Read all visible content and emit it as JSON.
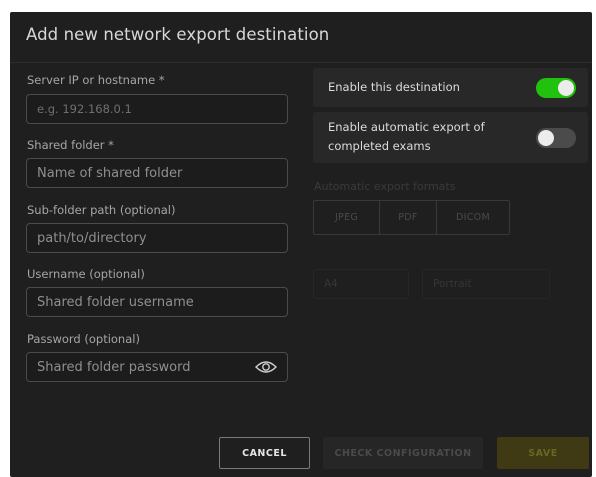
{
  "dialog": {
    "title": "Add new network export destination"
  },
  "form": {
    "server": {
      "label": "Server IP or hostname *",
      "placeholder": "e.g. 192.168.0.1"
    },
    "shared_folder": {
      "label": "Shared folder *",
      "placeholder": "Name of shared folder"
    },
    "sub_folder": {
      "label": "Sub-folder path (optional)",
      "placeholder": "path/to/directory"
    },
    "username": {
      "label": "Username (optional)",
      "placeholder": "Shared folder username"
    },
    "password": {
      "label": "Password (optional)",
      "placeholder": "Shared folder password",
      "icon": "eye-icon"
    }
  },
  "options": {
    "enable_destination": {
      "label": "Enable this destination",
      "on": true
    },
    "auto_export": {
      "label": "Enable automatic export of completed exams",
      "on": false
    }
  },
  "formats": {
    "label": "Automatic export formats",
    "items": [
      "JPEG",
      "PDF",
      "DICOM"
    ]
  },
  "pdf_settings": {
    "paper_size": "A4",
    "orientation": "Portrait"
  },
  "actions": {
    "cancel": "CANCEL",
    "check": "CHECK CONFIGURATION",
    "save": "SAVE"
  },
  "colors": {
    "toggle_on": "#20c20e",
    "toggle_off": "#4b4b4b",
    "save_disabled": "#3f3a13"
  }
}
